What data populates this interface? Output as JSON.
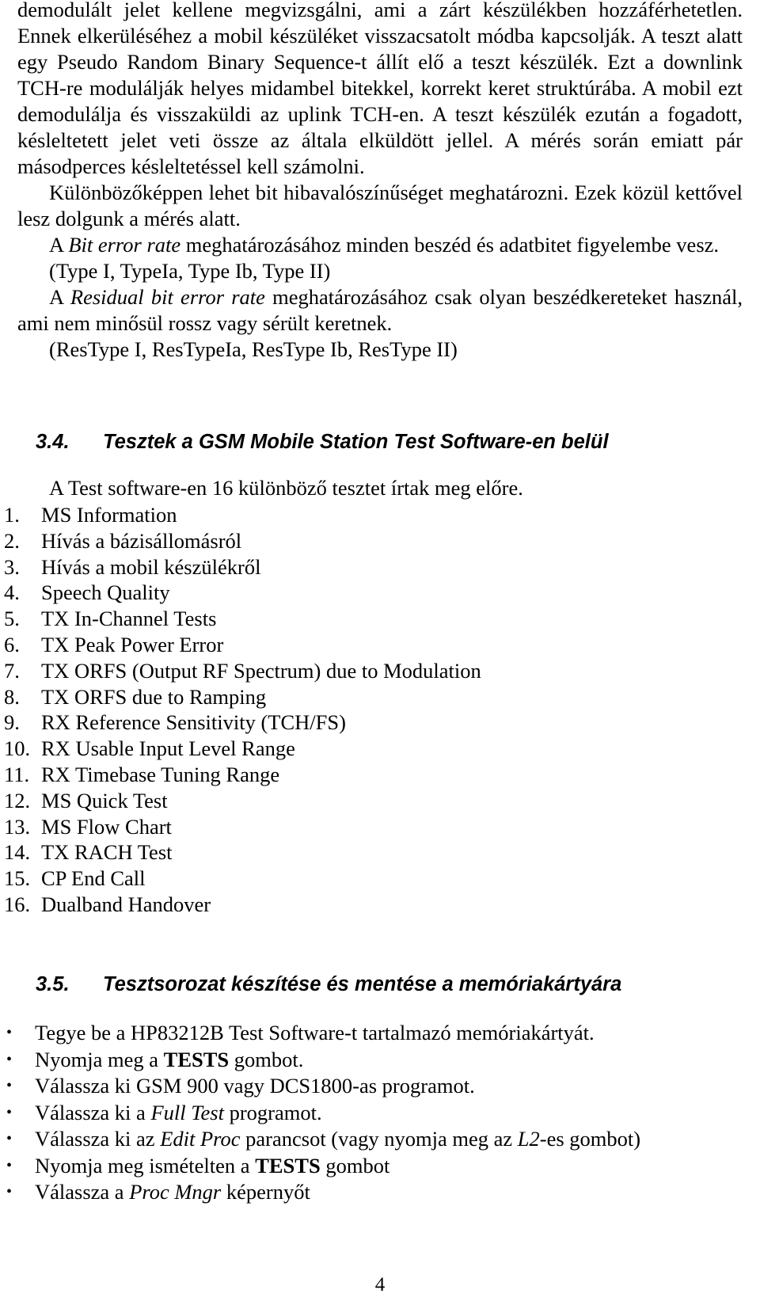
{
  "page": {
    "number": "4",
    "language": "hu"
  },
  "body": {
    "paragraph_1": {
      "run_1": "demodulált jelet kellene megvizsgálni, ami a zárt készülékben hozzáférhetetlen. Ennek elkerüléséhez a mobil készüléket visszacsatolt módba kapcsolják. A teszt alatt egy Pseudo Random Binary Sequence-t állít elő a teszt készülék. Ezt a downlink TCH-re modulálják helyes midambel bitekkel, korrekt keret struktúrába. A mobil ezt demodulálja és visszaküldi az uplink TCH-en. A teszt készülék ezután a fogadott, késleltetett jelet veti össze az általa elküldött jellel. A mérés során emiatt pár másodperces késleltetéssel kell számolni."
    },
    "paragraph_2": {
      "run_1": "Különbözőképpen lehet bit hibavalószínűséget meghatározni. Ezek közül kettővel lesz dolgunk a mérés alatt."
    },
    "paragraph_3": {
      "prefix": "A ",
      "italic_term": "Bit error rate",
      "suffix": " meghatározásához minden beszéd és adatbitet figyelembe vesz."
    },
    "paragraph_4": {
      "run_1": "(Type I, TypeIa, Type Ib, Type II)"
    },
    "paragraph_5": {
      "prefix": "A ",
      "italic_term": "Residual bit error rate",
      "suffix": " meghatározásához csak olyan beszédkereteket használ, ami nem minősül rossz vagy sérült keretnek."
    },
    "paragraph_6": {
      "run_1": "(ResType I, ResTypeIa, ResType Ib, ResType II)"
    }
  },
  "section_34": {
    "number": "3.4.",
    "title": "Tesztek a GSM Mobile Station Test Software-en belül",
    "intro": "A Test software-en 16 különböző tesztet írtak meg előre.",
    "tests": [
      {
        "n": "1.",
        "label": "MS Information"
      },
      {
        "n": "2.",
        "label": "Hívás a bázisállomásról"
      },
      {
        "n": "3.",
        "label": "Hívás a mobil készülékről"
      },
      {
        "n": "4.",
        "label": "Speech Quality"
      },
      {
        "n": "5.",
        "label": "TX In-Channel Tests"
      },
      {
        "n": "6.",
        "label": "TX Peak Power Error"
      },
      {
        "n": "7.",
        "label": "TX ORFS (Output RF Spectrum) due to Modulation"
      },
      {
        "n": "8.",
        "label": "TX ORFS due to Ramping"
      },
      {
        "n": "9.",
        "label": "RX Reference Sensitivity (TCH/FS)"
      },
      {
        "n": "10.",
        "label": "RX Usable Input Level Range"
      },
      {
        "n": "11.",
        "label": "RX Timebase Tuning Range"
      },
      {
        "n": "12.",
        "label": "MS Quick Test"
      },
      {
        "n": "13.",
        "label": "MS Flow Chart"
      },
      {
        "n": "14.",
        "label": "TX RACH Test"
      },
      {
        "n": "15.",
        "label": "CP End Call"
      },
      {
        "n": "16.",
        "label": "Dualband Handover"
      }
    ]
  },
  "section_35": {
    "number": "3.5.",
    "title": "Tesztsorozat készítése és mentése a memóriakártyára",
    "bullet_marker": "•",
    "steps": [
      {
        "prefix": "Tegye be a HP83212B Test Software-t tartalmazó memóriakártyát.",
        "emphasis": "",
        "emphasis_style": "none",
        "suffix": ""
      },
      {
        "prefix": "Nyomja meg a ",
        "emphasis": "TESTS",
        "emphasis_style": "bold",
        "suffix": " gombot."
      },
      {
        "prefix": "Válassza ki GSM 900 vagy DCS1800-as programot.",
        "emphasis": "",
        "emphasis_style": "none",
        "suffix": ""
      },
      {
        "prefix": "Válassza ki a ",
        "emphasis": "Full Test",
        "emphasis_style": "italic",
        "suffix": " programot."
      },
      {
        "prefix": "Válassza ki az ",
        "emphasis": "Edit Proc",
        "emphasis_style": "italic",
        "suffix": " parancsot (vagy nyomja meg az ",
        "emphasis2": "L2",
        "emphasis2_style": "italic",
        "suffix2": "-es gombot)"
      },
      {
        "prefix": "Nyomja meg ismételten a ",
        "emphasis": "TESTS",
        "emphasis_style": "bold",
        "suffix": " gombot"
      },
      {
        "prefix": "Válassza a ",
        "emphasis": "Proc Mngr",
        "emphasis_style": "italic",
        "suffix": " képernyőt"
      }
    ]
  },
  "colors": {
    "page_background": "#ffffff",
    "text": "#000000"
  }
}
